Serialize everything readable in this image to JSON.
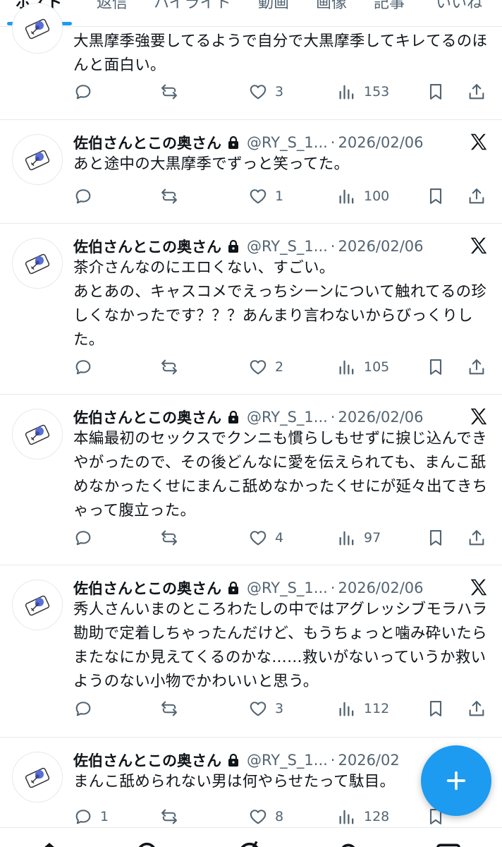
{
  "tabs": [
    {
      "label": "ポスト",
      "active": true
    },
    {
      "label": "返信",
      "active": false
    },
    {
      "label": "ハイライト",
      "active": false
    },
    {
      "label": "動画",
      "active": false
    },
    {
      "label": "画像",
      "active": false
    },
    {
      "label": "記事",
      "active": false
    },
    {
      "label": "いいね",
      "active": false
    }
  ],
  "colors": {
    "accent": "#1d9bf0",
    "text": "#0f1419",
    "muted": "#536471",
    "border": "#e6e9ec"
  },
  "posts": [
    {
      "author": "",
      "handle": "",
      "date": "",
      "text": "大黒摩季強要してるようで自分で大黒摩季してキレてるのほんと面白い。",
      "replies": "",
      "retweets": "",
      "likes": "3",
      "views": "153"
    },
    {
      "author": "佐伯さんとこの奥さん",
      "handle": "@RY_S_1...",
      "date": "2026/02/06",
      "text": "あと途中の大黒摩季でずっと笑ってた。",
      "replies": "",
      "retweets": "",
      "likes": "1",
      "views": "100"
    },
    {
      "author": "佐伯さんとこの奥さん",
      "handle": "@RY_S_1...",
      "date": "2026/02/06",
      "text": "茶介さんなのにエロくない、すごい。\nあとあの、キャスコメでえっちシーンについて触れてるの珍しくなかったです？？？あんまり言わないからびっくりした。",
      "replies": "",
      "retweets": "",
      "likes": "2",
      "views": "105"
    },
    {
      "author": "佐伯さんとこの奥さん",
      "handle": "@RY_S_1...",
      "date": "2026/02/06",
      "text": "本編最初のセックスでクンニも慣らしもせずに捩じ込んできやがったので、その後どんなに愛を伝えられても、まんこ舐めなかったくせにまんこ舐めなかったくせにが延々出てきちゃって腹立った。",
      "replies": "",
      "retweets": "",
      "likes": "4",
      "views": "97"
    },
    {
      "author": "佐伯さんとこの奥さん",
      "handle": "@RY_S_1...",
      "date": "2026/02/06",
      "text": "秀人さんいまのところわたしの中ではアグレッシブモラハラ勘助で定着しちゃったんだけど、もうちょっと噛み砕いたらまたなにか見えてくるのかな……救いがないっていうか救いようのない小物でかわいいと思う。",
      "replies": "",
      "retweets": "",
      "likes": "3",
      "views": "112"
    },
    {
      "author": "佐伯さんとこの奥さん",
      "handle": "@RY_S_1...",
      "date": "2026/02",
      "text": "まんこ舐められない男は何やらせたって駄目。",
      "replies": "1",
      "retweets": "",
      "likes": "8",
      "views": "128"
    }
  ]
}
